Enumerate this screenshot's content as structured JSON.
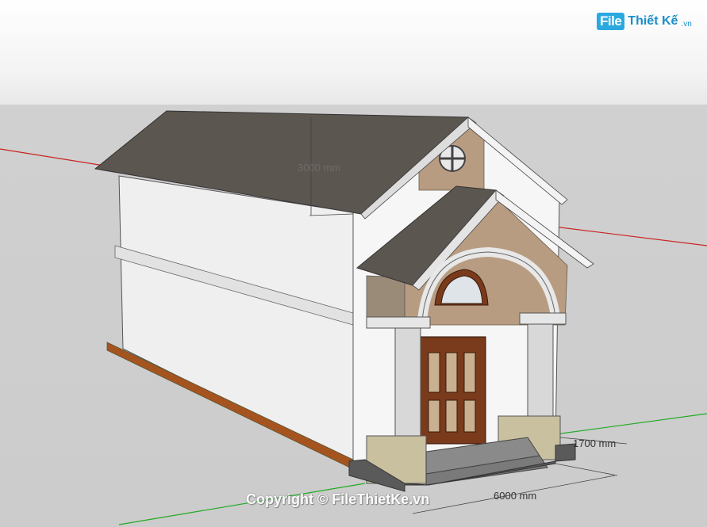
{
  "watermark": {
    "badge": "File",
    "name": "Thiết Kế",
    "tld": ".vn"
  },
  "dimensions": {
    "height_ghost": "3000 mm",
    "porch_width": "1700 mm",
    "house_width": "6000 mm"
  },
  "copyright": "Copyright © FileThietKe.vn",
  "colors": {
    "sky": "#f3f3f3",
    "ground": "#cccccc",
    "roof": "#5c5650",
    "wall": "#f2f2f2",
    "siding": "#b89c82",
    "door": "#7a3a1c",
    "red_axis": "#cc2222",
    "green_axis": "#22aa22",
    "brand": "#29a9e0"
  }
}
